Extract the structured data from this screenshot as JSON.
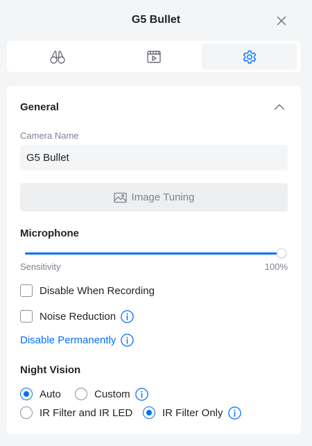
{
  "header": {
    "title": "G5 Bullet"
  },
  "tabs": [
    {
      "icon": "binoculars-icon"
    },
    {
      "icon": "video-clip-icon"
    },
    {
      "icon": "gear-icon",
      "active": true
    }
  ],
  "general": {
    "title": "General",
    "camera_name_label": "Camera Name",
    "camera_name_value": "G5 Bullet",
    "image_tuning_label": "Image Tuning"
  },
  "microphone": {
    "title": "Microphone",
    "sensitivity_label": "Sensitivity",
    "sensitivity_value": "100%",
    "sensitivity_level": 1.0,
    "disable_when_recording_label": "Disable When Recording",
    "noise_reduction_label": "Noise Reduction",
    "disable_permanently_label": "Disable Permanently"
  },
  "night_vision": {
    "title": "Night Vision",
    "options": [
      {
        "label": "Auto",
        "checked": true
      },
      {
        "label": "Custom",
        "checked": false
      },
      {
        "label": "IR Filter and IR LED",
        "checked": false
      },
      {
        "label": "IR Filter Only",
        "checked": true
      }
    ]
  },
  "colors": {
    "accent": "#006fff",
    "muted_text": "#7e8190",
    "text": "#212327"
  }
}
